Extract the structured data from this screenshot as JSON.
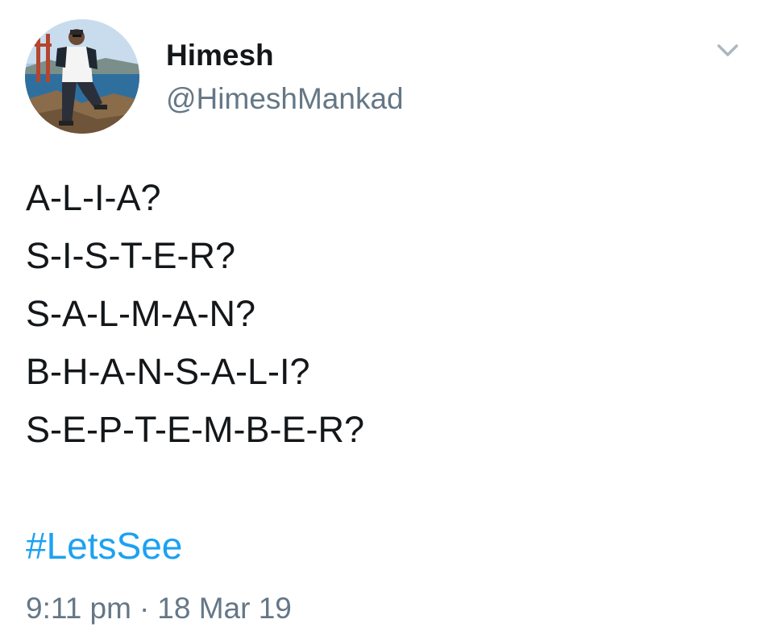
{
  "author": {
    "display_name": "Himesh",
    "handle": "@HimeshMankad",
    "avatar_icon": "profile-photo"
  },
  "tweet": {
    "lines": [
      "A-L-I-A?",
      "S-I-S-T-E-R?",
      "S-A-L-M-A-N?",
      "B-H-A-N-S-A-L-I?",
      "S-E-P-T-E-M-B-E-R?"
    ],
    "hashtag": "#LetsSee",
    "time": "9:11 pm",
    "separator": "·",
    "date": "18 Mar 19"
  },
  "menu": {
    "icon": "chevron-down-icon"
  },
  "colors": {
    "text": "#14171a",
    "secondary": "#657786",
    "link": "#1da1f2"
  }
}
